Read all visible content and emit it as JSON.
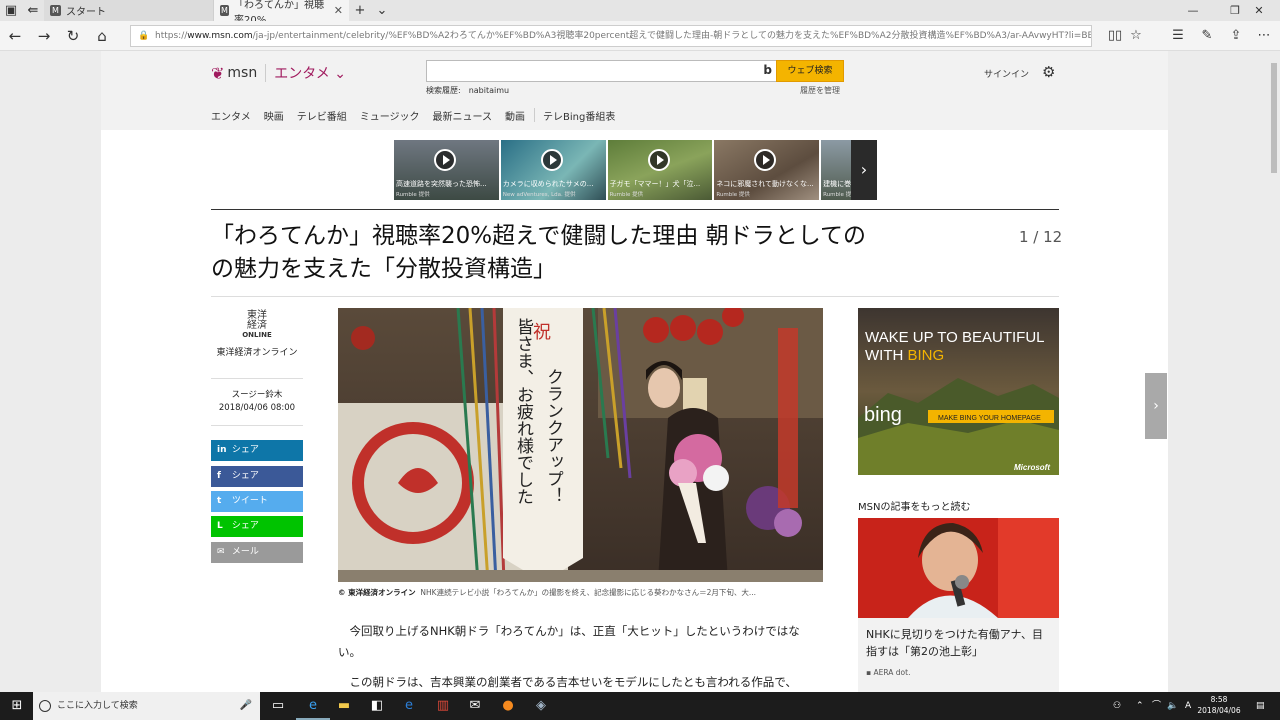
{
  "browser": {
    "tabs": [
      {
        "label": "スタート",
        "active": false
      },
      {
        "label": "「わろてんか」視聴率20%",
        "active": true
      }
    ],
    "url_prefix": "https://",
    "url_host": "www.msn.com",
    "url_path": "/ja-jp/entertainment/celebrity/%EF%BD%A2わろてんか%EF%BD%A3視聴率20percent超えで健闘した理由-朝ドラとしての魅力を支えた%EF%BD%A2分散投資構造%EF%BD%A3/ar-AAvwyHT?li=BBfTjut&ocid=spartandhp#page=2"
  },
  "msn": {
    "logo": "msn",
    "category": "エンタメ",
    "search_button": "ウェブ検索",
    "history_label": "検索履歴:",
    "history_value": "nabitaimu",
    "history_manage": "履歴を管理",
    "signin": "サインイン",
    "nav": [
      "エンタメ",
      "映画",
      "テレビ番組",
      "ミュージック",
      "最新ニュース",
      "動画",
      "テレBing番組表"
    ]
  },
  "videos": [
    {
      "title": "高速道路を突然襲った恐怖...",
      "source": "Rumble 提供"
    },
    {
      "title": "カメラに収められたサメの...",
      "source": "New adVentures, Lda. 提供"
    },
    {
      "title": "子ガモ「ママー！」犬「泣...",
      "source": "Rumble 提供"
    },
    {
      "title": "ネコに邪魔されて動けなくな...",
      "source": "Rumble 提供"
    },
    {
      "title": "建機に巻...",
      "source": "Rumble 提供"
    }
  ],
  "article": {
    "title_line1": "「わろてんか」視聴率20%超えで健闘した理由 朝ドラとしての",
    "title_line2": "の魅力を支えた「分散投資構造」",
    "page_indicator": "1 / 12",
    "source_logo_top": "東洋",
    "source_logo_mid": "経済",
    "source_logo_bot": "ONLINE",
    "source_name": "東洋経済オンライン",
    "author": "スージー鈴木",
    "date": "2018/04/06 08:00",
    "share": [
      {
        "icon": "in",
        "label": "シェア",
        "color": "#0e76a8"
      },
      {
        "icon": "f",
        "label": "シェア",
        "color": "#3b5998"
      },
      {
        "icon": "t",
        "label": "ツイート",
        "color": "#55acee"
      },
      {
        "icon": "L",
        "label": "シェア",
        "color": "#00c300"
      },
      {
        "icon": "✉",
        "label": "メール",
        "color": "#9a9a9a"
      }
    ],
    "image_banner_1": "祝 クランクアップ！",
    "image_banner_2": "皆さま、お疲れ様でした",
    "caption_credit": "© 東洋経済オンライン",
    "caption_text": "NHK連続テレビ小説「わろてんか」の撮影を終え、記念撮影に応じる葵わかなさん＝2月下旬、大...",
    "para1": "今回取り上げるNHK朝ドラ「わろてんか」は、正直「大ヒット」したというわけではない。",
    "para2": "この朝ドラは、吉本興業の創業者である吉本せいをモデルにしたとも言われる作品で、"
  },
  "sidebar": {
    "ad_line1": "WAKE UP TO BEAUTIFUL",
    "ad_line2_a": "WITH ",
    "ad_line2_b": "BING",
    "ad_brand": "bing",
    "ad_cta": "MAKE BING YOUR HOMEPAGE",
    "ad_ms": "Microsoft",
    "more_heading": "MSNの記事をもっと読む",
    "more_title": "NHKに見切りをつけた有働アナ、目指すは「第2の池上彰」",
    "more_source": "AERA dot."
  },
  "taskbar": {
    "search_placeholder": "ここに入力して検索",
    "time": "8:58",
    "date": "2018/04/06",
    "ime": "A"
  }
}
